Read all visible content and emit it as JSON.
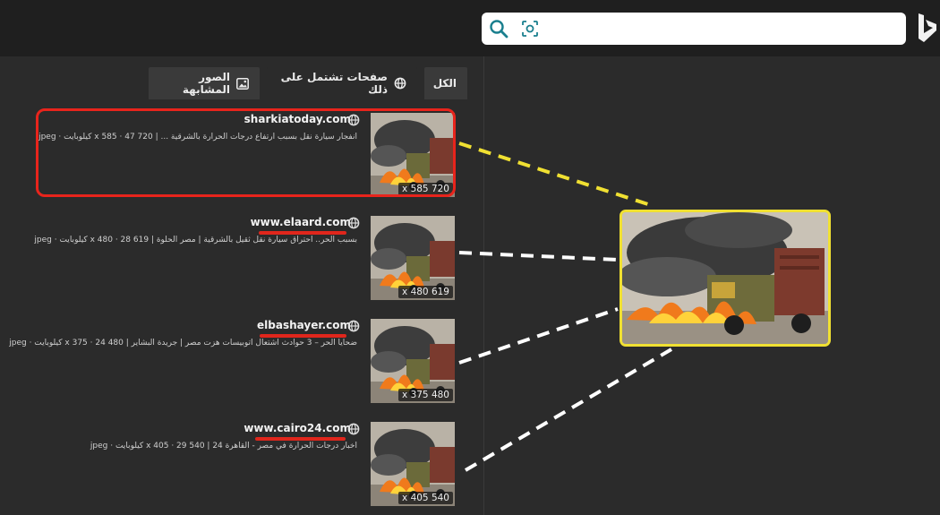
{
  "search": {
    "value": "",
    "placeholder": ""
  },
  "tabs": [
    {
      "label": "الكل",
      "icon": "none"
    },
    {
      "label": "صفحات تشتمل على ذلك",
      "icon": "globe-icon"
    },
    {
      "label": "الصور المشابهة",
      "icon": "image-icon"
    }
  ],
  "results": [
    {
      "site": "sharkiatoday.com",
      "description": "انفجار سيارة نقل بسبب ارتفاع درجات الحرارة بالشرقية ... | 720 47 · 585 x كيلوبايت · jpeg",
      "dims": "x 585 720"
    },
    {
      "site": "www.elaard.com",
      "description": "بسبب الحر.. احتراق سيارة نقل ثقيل بالشرقية | مصر الحلوة | 619 28 · 480 x كيلوبايت · jpeg",
      "dims": "x 480 619"
    },
    {
      "site": "elbashayer.com",
      "description": "ضحايا الحر – 3 حوادث اشتعال اتوبيسات هزت مصر | جريدة البشاير | 480 24 · 375 x كيلوبايت · jpeg",
      "dims": "x 375 480"
    },
    {
      "site": "www.cairo24.com",
      "description": "اخبار درجات الحرارة في مصر - القاهرة 24 | 540 29 · 405 x كيلوبايت · jpeg",
      "dims": "x 405 540"
    }
  ],
  "colors": {
    "highlight_red": "#e8241c",
    "highlight_yellow": "#f0e032",
    "accent_teal": "#1a7f8e"
  }
}
